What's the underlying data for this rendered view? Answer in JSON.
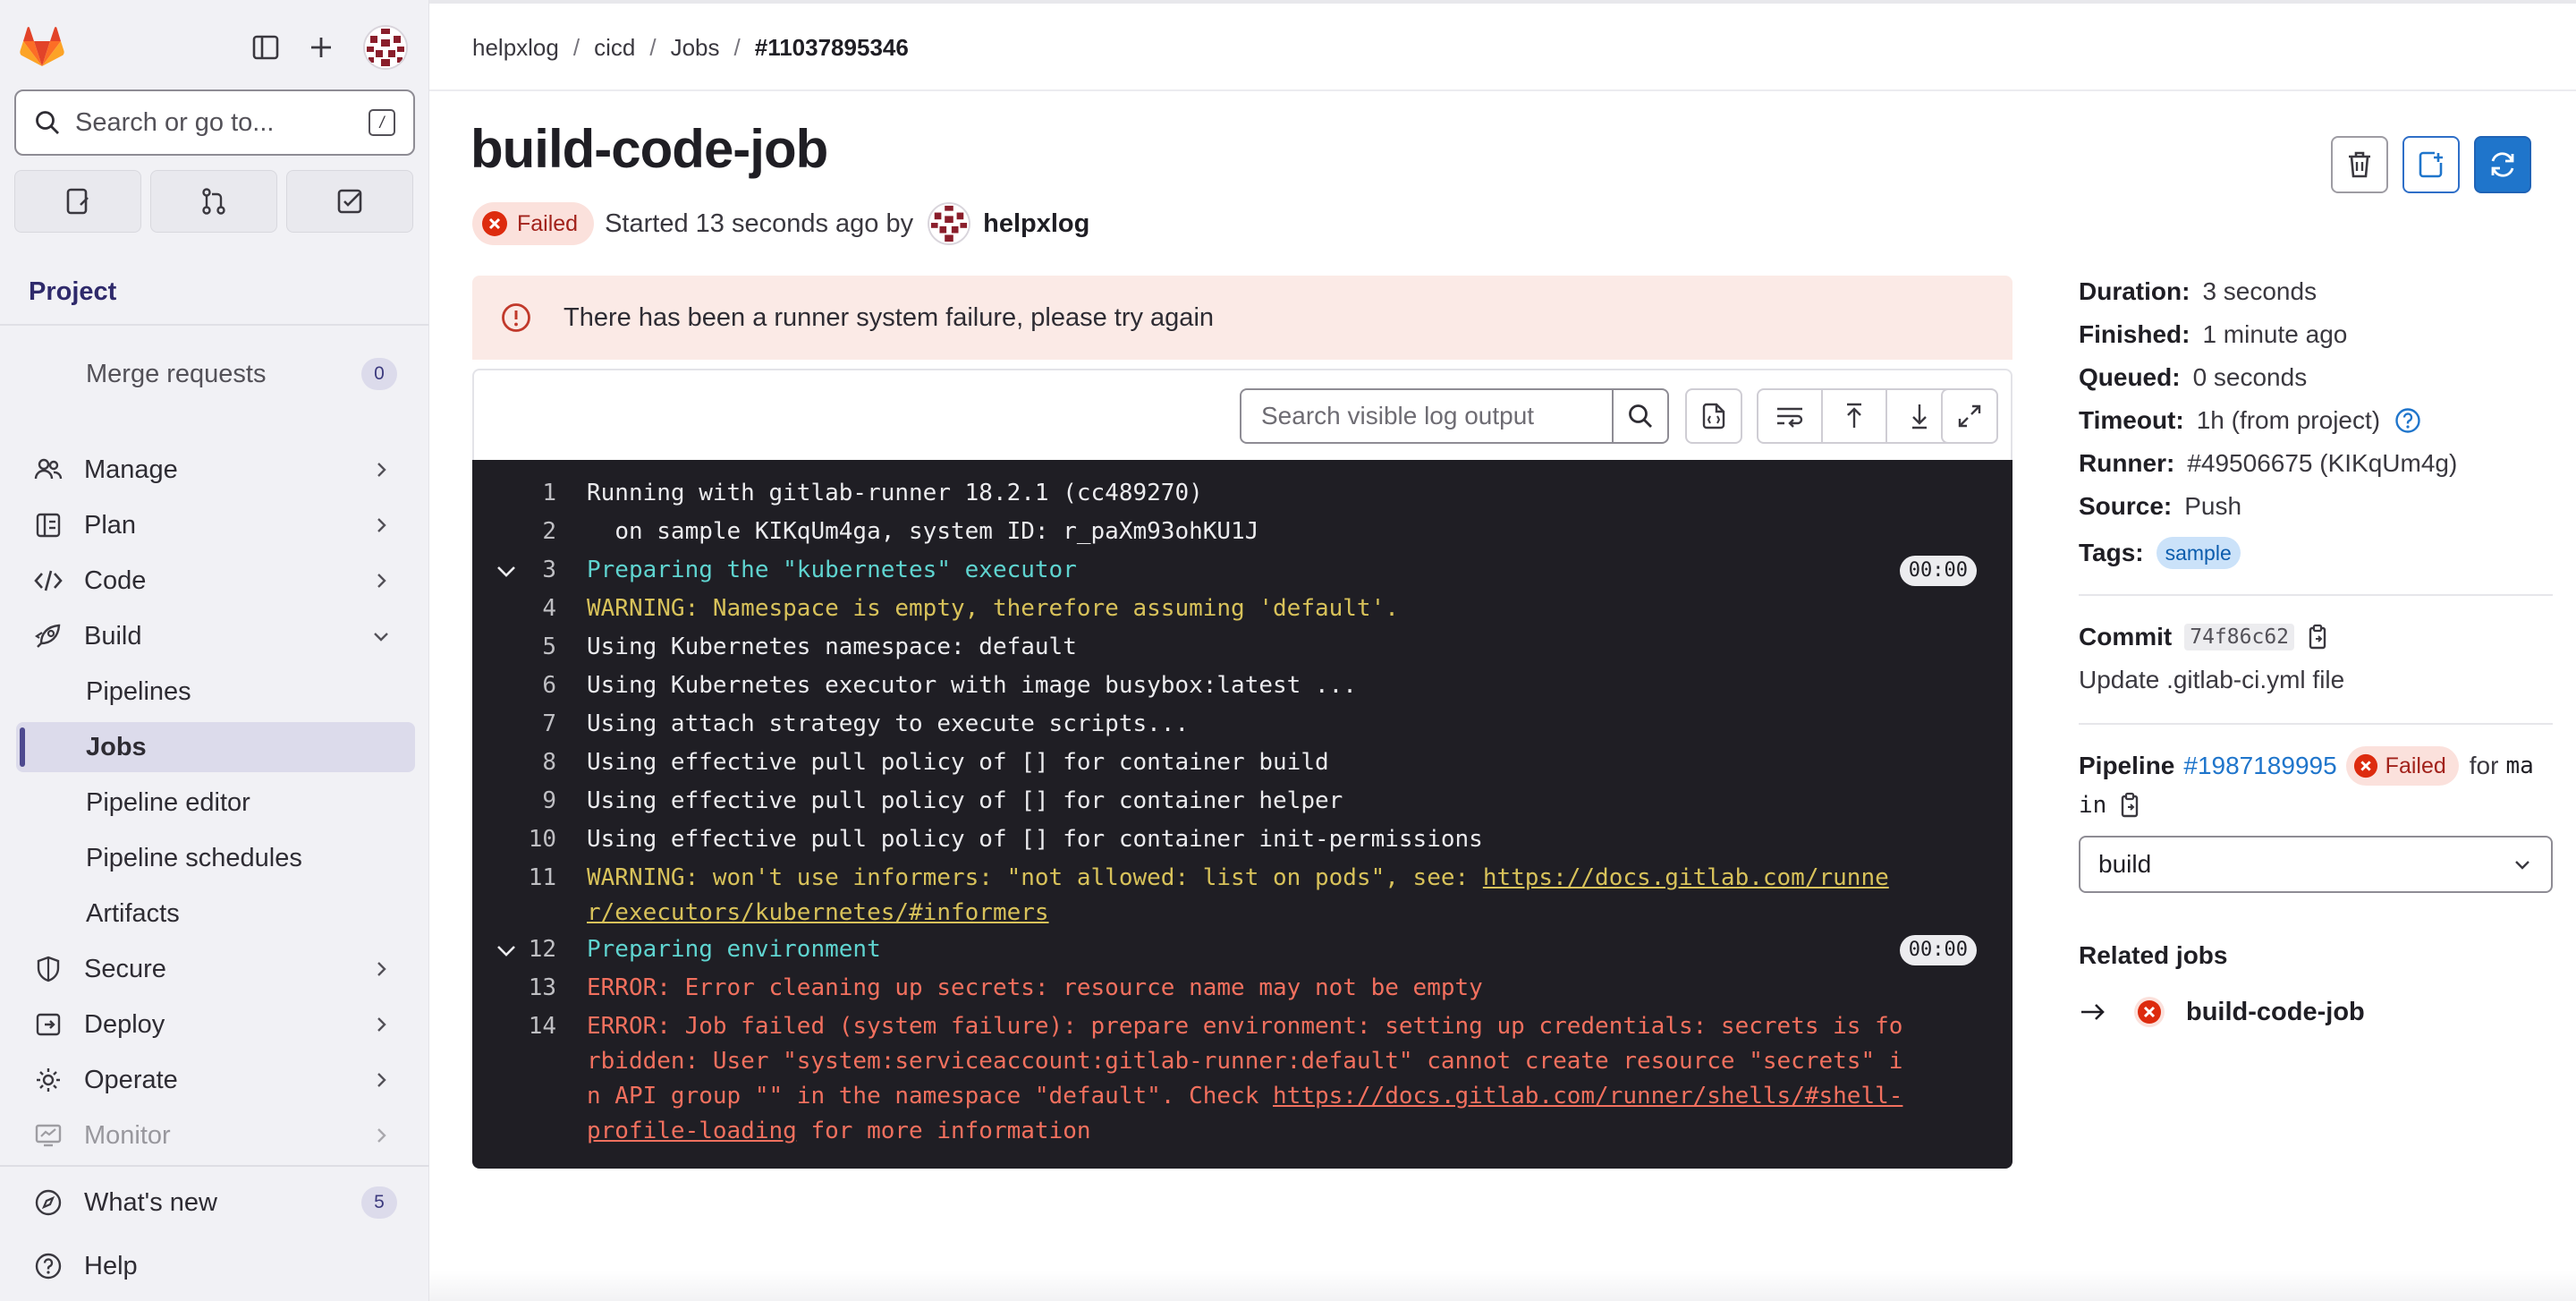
{
  "sidebar": {
    "search_placeholder": "Search or go to...",
    "search_shortcut": "/",
    "section_title": "Project",
    "merge_requests": {
      "label": "Merge requests",
      "count": "0"
    },
    "items": [
      {
        "label": "Manage",
        "icon": "users-icon"
      },
      {
        "label": "Plan",
        "icon": "planning-icon"
      },
      {
        "label": "Code",
        "icon": "code-icon"
      },
      {
        "label": "Build",
        "icon": "rocket-icon"
      }
    ],
    "build_subitems": [
      "Pipelines",
      "Jobs",
      "Pipeline editor",
      "Pipeline schedules",
      "Artifacts"
    ],
    "active_subitem": "Jobs",
    "items_after": [
      {
        "label": "Secure",
        "icon": "shield-icon"
      },
      {
        "label": "Deploy",
        "icon": "deploy-icon"
      },
      {
        "label": "Operate",
        "icon": "cloud-gear-icon"
      },
      {
        "label": "Monitor",
        "icon": "monitor-icon"
      }
    ],
    "whats_new": {
      "label": "What's new",
      "count": "5"
    },
    "help": {
      "label": "Help"
    }
  },
  "breadcrumb": [
    "helpxlog",
    "cicd",
    "Jobs",
    "#11037895346"
  ],
  "job": {
    "title": "build-code-job",
    "status": "Failed",
    "started_text": "Started 13 seconds ago by",
    "user": "helpxlog"
  },
  "alert": {
    "text": "There has been a runner system failure, please try again"
  },
  "log_toolbar": {
    "search_placeholder": "Search visible log output"
  },
  "log": {
    "lines": [
      {
        "n": "1",
        "text": "Running with gitlab-runner 18.2.1 (cc489270)",
        "cls": ""
      },
      {
        "n": "2",
        "text": "  on sample KIKqUm4ga, system ID: r_paXm93ohKU1J",
        "cls": ""
      },
      {
        "n": "3",
        "text": "Preparing the \"kubernetes\" executor",
        "cls": "cyan",
        "duration": "00:00"
      },
      {
        "n": "4",
        "text": "WARNING: Namespace is empty, therefore assuming 'default'.",
        "cls": "yellow"
      },
      {
        "n": "5",
        "text": "Using Kubernetes namespace: default",
        "cls": ""
      },
      {
        "n": "6",
        "text": "Using Kubernetes executor with image busybox:latest ...",
        "cls": ""
      },
      {
        "n": "7",
        "text": "Using attach strategy to execute scripts...",
        "cls": ""
      },
      {
        "n": "8",
        "text": "Using effective pull policy of [] for container build",
        "cls": ""
      },
      {
        "n": "9",
        "text": "Using effective pull policy of [] for container helper",
        "cls": ""
      },
      {
        "n": "10",
        "text": "Using effective pull policy of [] for container init-permissions",
        "cls": ""
      },
      {
        "n": "11",
        "text_pre": "WARNING: won't use informers: \"not allowed: list on pods\", see: ",
        "link": "https://docs.gitlab.com/runner/executors/kubernetes/#informers",
        "text_post": "",
        "cls": "yellow"
      },
      {
        "n": "12",
        "text": "Preparing environment",
        "cls": "cyan",
        "duration": "00:00"
      },
      {
        "n": "13",
        "text": "ERROR: Error cleaning up secrets: resource name may not be empty",
        "cls": "red"
      },
      {
        "n": "14",
        "text_pre": "ERROR: Job failed (system failure): prepare environment: setting up credentials: secrets is forbidden: User \"system:serviceaccount:gitlab-runner:default\" cannot create resource \"secrets\" in API group \"\" in the namespace \"default\". Check ",
        "link": "https://docs.gitlab.com/runner/shells/#shell-profile-loading",
        "text_post": " for more information",
        "cls": "red"
      }
    ]
  },
  "details": {
    "duration": {
      "k": "Duration:",
      "v": "3 seconds"
    },
    "finished": {
      "k": "Finished:",
      "v": "1 minute ago"
    },
    "queued": {
      "k": "Queued:",
      "v": "0 seconds"
    },
    "timeout": {
      "k": "Timeout:",
      "v": "1h (from project)"
    },
    "runner": {
      "k": "Runner:",
      "v": "#49506675 (KIKqUm4g)"
    },
    "source": {
      "k": "Source:",
      "v": "Push"
    },
    "tags": {
      "k": "Tags:",
      "v": "sample"
    },
    "commit": {
      "k": "Commit",
      "sha": "74f86c62",
      "message": "Update .gitlab-ci.yml file"
    },
    "pipeline": {
      "k": "Pipeline",
      "id": "#1987189995",
      "status": "Failed",
      "for": "for",
      "ref_a": "ma",
      "ref_b": "in"
    },
    "stage_select": "build",
    "related_title": "Related jobs",
    "related_job": "build-code-job"
  },
  "colors": {
    "accent": "#1f75cb",
    "danger": "#dd2b0e",
    "log_bg": "#1f1e24",
    "sidebar_bg": "#f1f1f5"
  }
}
